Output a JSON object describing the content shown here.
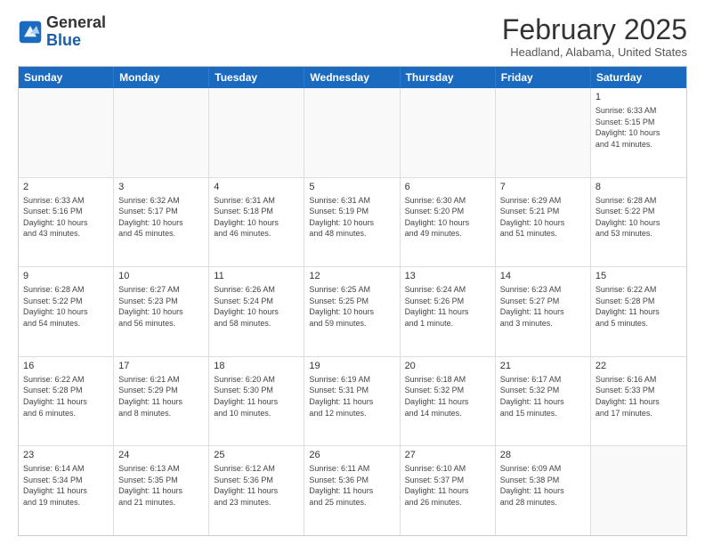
{
  "header": {
    "logo": {
      "line1": "General",
      "line2": "Blue"
    },
    "title": "February 2025",
    "subtitle": "Headland, Alabama, United States"
  },
  "weekdays": [
    "Sunday",
    "Monday",
    "Tuesday",
    "Wednesday",
    "Thursday",
    "Friday",
    "Saturday"
  ],
  "rows": [
    [
      {
        "day": "",
        "info": ""
      },
      {
        "day": "",
        "info": ""
      },
      {
        "day": "",
        "info": ""
      },
      {
        "day": "",
        "info": ""
      },
      {
        "day": "",
        "info": ""
      },
      {
        "day": "",
        "info": ""
      },
      {
        "day": "1",
        "info": "Sunrise: 6:33 AM\nSunset: 5:15 PM\nDaylight: 10 hours\nand 41 minutes."
      }
    ],
    [
      {
        "day": "2",
        "info": "Sunrise: 6:33 AM\nSunset: 5:16 PM\nDaylight: 10 hours\nand 43 minutes."
      },
      {
        "day": "3",
        "info": "Sunrise: 6:32 AM\nSunset: 5:17 PM\nDaylight: 10 hours\nand 45 minutes."
      },
      {
        "day": "4",
        "info": "Sunrise: 6:31 AM\nSunset: 5:18 PM\nDaylight: 10 hours\nand 46 minutes."
      },
      {
        "day": "5",
        "info": "Sunrise: 6:31 AM\nSunset: 5:19 PM\nDaylight: 10 hours\nand 48 minutes."
      },
      {
        "day": "6",
        "info": "Sunrise: 6:30 AM\nSunset: 5:20 PM\nDaylight: 10 hours\nand 49 minutes."
      },
      {
        "day": "7",
        "info": "Sunrise: 6:29 AM\nSunset: 5:21 PM\nDaylight: 10 hours\nand 51 minutes."
      },
      {
        "day": "8",
        "info": "Sunrise: 6:28 AM\nSunset: 5:22 PM\nDaylight: 10 hours\nand 53 minutes."
      }
    ],
    [
      {
        "day": "9",
        "info": "Sunrise: 6:28 AM\nSunset: 5:22 PM\nDaylight: 10 hours\nand 54 minutes."
      },
      {
        "day": "10",
        "info": "Sunrise: 6:27 AM\nSunset: 5:23 PM\nDaylight: 10 hours\nand 56 minutes."
      },
      {
        "day": "11",
        "info": "Sunrise: 6:26 AM\nSunset: 5:24 PM\nDaylight: 10 hours\nand 58 minutes."
      },
      {
        "day": "12",
        "info": "Sunrise: 6:25 AM\nSunset: 5:25 PM\nDaylight: 10 hours\nand 59 minutes."
      },
      {
        "day": "13",
        "info": "Sunrise: 6:24 AM\nSunset: 5:26 PM\nDaylight: 11 hours\nand 1 minute."
      },
      {
        "day": "14",
        "info": "Sunrise: 6:23 AM\nSunset: 5:27 PM\nDaylight: 11 hours\nand 3 minutes."
      },
      {
        "day": "15",
        "info": "Sunrise: 6:22 AM\nSunset: 5:28 PM\nDaylight: 11 hours\nand 5 minutes."
      }
    ],
    [
      {
        "day": "16",
        "info": "Sunrise: 6:22 AM\nSunset: 5:28 PM\nDaylight: 11 hours\nand 6 minutes."
      },
      {
        "day": "17",
        "info": "Sunrise: 6:21 AM\nSunset: 5:29 PM\nDaylight: 11 hours\nand 8 minutes."
      },
      {
        "day": "18",
        "info": "Sunrise: 6:20 AM\nSunset: 5:30 PM\nDaylight: 11 hours\nand 10 minutes."
      },
      {
        "day": "19",
        "info": "Sunrise: 6:19 AM\nSunset: 5:31 PM\nDaylight: 11 hours\nand 12 minutes."
      },
      {
        "day": "20",
        "info": "Sunrise: 6:18 AM\nSunset: 5:32 PM\nDaylight: 11 hours\nand 14 minutes."
      },
      {
        "day": "21",
        "info": "Sunrise: 6:17 AM\nSunset: 5:32 PM\nDaylight: 11 hours\nand 15 minutes."
      },
      {
        "day": "22",
        "info": "Sunrise: 6:16 AM\nSunset: 5:33 PM\nDaylight: 11 hours\nand 17 minutes."
      }
    ],
    [
      {
        "day": "23",
        "info": "Sunrise: 6:14 AM\nSunset: 5:34 PM\nDaylight: 11 hours\nand 19 minutes."
      },
      {
        "day": "24",
        "info": "Sunrise: 6:13 AM\nSunset: 5:35 PM\nDaylight: 11 hours\nand 21 minutes."
      },
      {
        "day": "25",
        "info": "Sunrise: 6:12 AM\nSunset: 5:36 PM\nDaylight: 11 hours\nand 23 minutes."
      },
      {
        "day": "26",
        "info": "Sunrise: 6:11 AM\nSunset: 5:36 PM\nDaylight: 11 hours\nand 25 minutes."
      },
      {
        "day": "27",
        "info": "Sunrise: 6:10 AM\nSunset: 5:37 PM\nDaylight: 11 hours\nand 26 minutes."
      },
      {
        "day": "28",
        "info": "Sunrise: 6:09 AM\nSunset: 5:38 PM\nDaylight: 11 hours\nand 28 minutes."
      },
      {
        "day": "",
        "info": ""
      }
    ]
  ]
}
